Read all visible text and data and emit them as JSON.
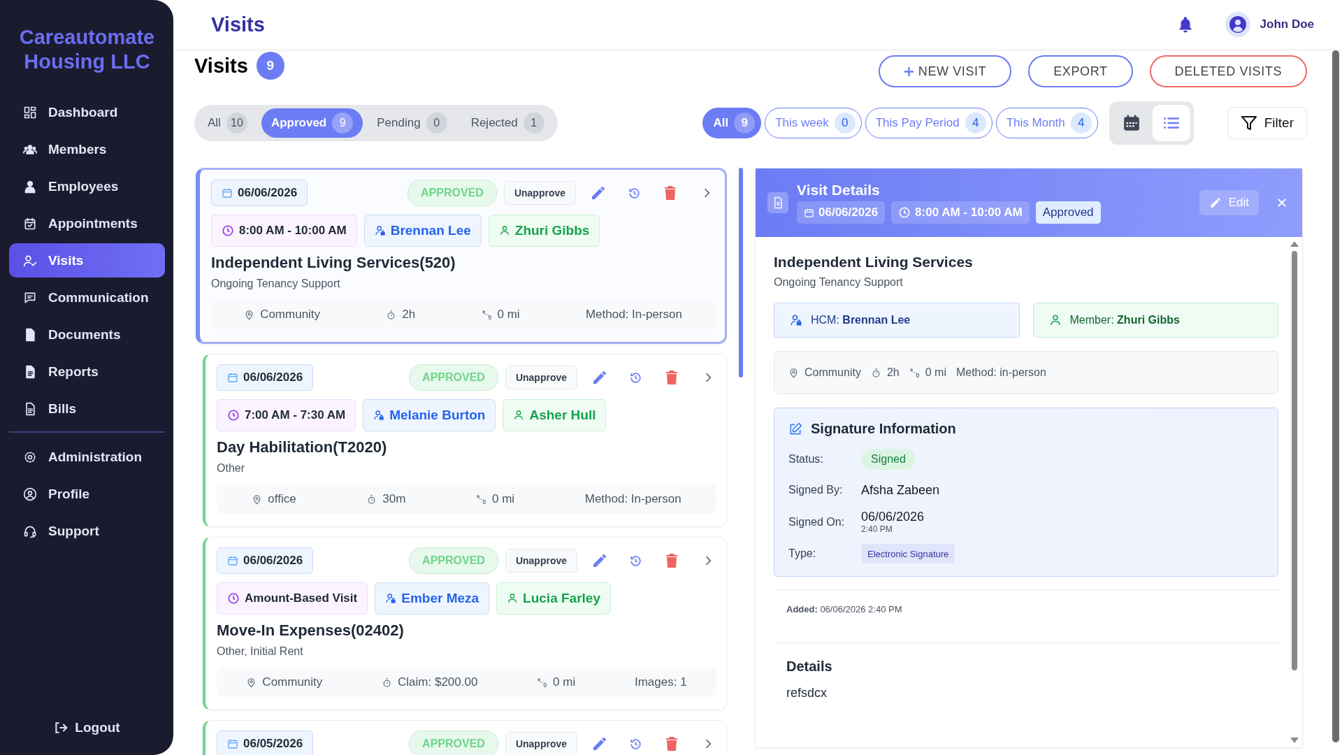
{
  "sidebar": {
    "brand": "Careautomate Housing LLC",
    "nav": [
      {
        "label": "Dashboard",
        "selected": false
      },
      {
        "label": "Members",
        "selected": false
      },
      {
        "label": "Employees",
        "selected": false
      },
      {
        "label": "Appointments",
        "selected": false
      },
      {
        "label": "Visits",
        "selected": true
      },
      {
        "label": "Communication",
        "selected": false
      },
      {
        "label": "Documents",
        "selected": false
      },
      {
        "label": "Reports",
        "selected": false
      },
      {
        "label": "Bills",
        "selected": false
      }
    ],
    "nav_bottom": [
      {
        "label": "Administration",
        "selected": false
      },
      {
        "label": "Profile",
        "selected": false
      },
      {
        "label": "Support",
        "selected": false
      }
    ],
    "logout": "Logout"
  },
  "header": {
    "title": "Visits",
    "user": "John Doe"
  },
  "page": {
    "title": "Visits",
    "count": "9"
  },
  "actions": [
    {
      "label": "NEW VISIT",
      "kind": "add"
    },
    {
      "label": "EXPORT",
      "kind": "default"
    },
    {
      "label": "DELETED VISITS",
      "kind": "danger"
    }
  ],
  "status_tabs": [
    {
      "label": "All",
      "count": "10",
      "selected": false
    },
    {
      "label": "Approved",
      "count": "9",
      "selected": true
    },
    {
      "label": "Pending",
      "count": "0",
      "selected": false
    },
    {
      "label": "Rejected",
      "count": "1",
      "selected": false
    }
  ],
  "period_filters": [
    {
      "label": "All",
      "count": "9",
      "selected": true
    },
    {
      "label": "This week",
      "count": "0",
      "selected": false
    },
    {
      "label": "This Pay Period",
      "count": "4",
      "selected": false
    },
    {
      "label": "This Month",
      "count": "4",
      "selected": false
    }
  ],
  "view_toggle": [
    {
      "kind": "calendar",
      "selected": false
    },
    {
      "kind": "list",
      "selected": true
    }
  ],
  "filter_button": "Filter",
  "visits": [
    {
      "selected": true,
      "date": "06/06/2026",
      "status": "APPROVED",
      "action": "Unapprove",
      "time": "8:00 AM - 10:00 AM",
      "hcm": "Brennan Lee",
      "member": "Zhuri Gibbs",
      "service": "Independent Living Services(520)",
      "subtitle": "Ongoing Tenancy Support",
      "meta": [
        {
          "kind": "location",
          "text": "Community"
        },
        {
          "kind": "duration",
          "text": "2h"
        },
        {
          "kind": "mileage",
          "text": "0 mi"
        },
        {
          "kind": "text",
          "text": "Method: In-person"
        }
      ]
    },
    {
      "selected": false,
      "date": "06/06/2026",
      "status": "APPROVED",
      "action": "Unapprove",
      "time": "7:00 AM - 7:30 AM",
      "hcm": "Melanie Burton",
      "member": "Asher Hull",
      "service": "Day Habilitation(T2020)",
      "subtitle": "Other",
      "meta": [
        {
          "kind": "location",
          "text": "office"
        },
        {
          "kind": "duration",
          "text": "30m"
        },
        {
          "kind": "mileage",
          "text": "0 mi"
        },
        {
          "kind": "text",
          "text": "Method: In-person"
        }
      ]
    },
    {
      "selected": false,
      "date": "06/06/2026",
      "status": "APPROVED",
      "action": "Unapprove",
      "time": "Amount-Based Visit",
      "hcm": "Ember Meza",
      "member": "Lucia Farley",
      "service": "Move-In Expenses(02402)",
      "subtitle": "Other, Initial Rent",
      "meta": [
        {
          "kind": "location",
          "text": "Community"
        },
        {
          "kind": "duration",
          "text": "Claim: $200.00"
        },
        {
          "kind": "mileage",
          "text": "0 mi"
        },
        {
          "kind": "text",
          "text": "Images: 1"
        }
      ]
    },
    {
      "selected": false,
      "date": "06/05/2026",
      "status": "APPROVED",
      "action": "Unapprove"
    }
  ],
  "details": {
    "title": "Visit Details",
    "date": "06/06/2026",
    "time": "8:00 AM - 10:00 AM",
    "status": "Approved",
    "edit": "Edit",
    "service": "Independent Living Services",
    "subtitle": "Ongoing Tenancy Support",
    "hcm": "HCM: **Brennan Lee**",
    "member": "Member: **Zhuri Gibbs**",
    "meta": [
      {
        "kind": "location",
        "text": "Community"
      },
      {
        "kind": "duration",
        "text": "2h"
      },
      {
        "kind": "mileage",
        "text": "0 mi"
      },
      {
        "kind": "text",
        "text": "Method: in-person"
      }
    ],
    "signature": {
      "title": "Signature Information",
      "rows": [
        {
          "kind": "badge",
          "label": "Status:",
          "value": "Signed"
        },
        {
          "kind": "text",
          "label": "Signed By:",
          "value": "Afsha Zabeen"
        },
        {
          "kind": "datetime",
          "label": "Signed On:",
          "value": "06/06/2026",
          "sub": "2:40 PM"
        },
        {
          "kind": "tag",
          "label": "Type:",
          "value": "Electronic Signature"
        }
      ]
    },
    "added": "**Added:** 06/06/2026 2:40 PM",
    "details_title": "Details",
    "details_text": "refsdcx"
  }
}
